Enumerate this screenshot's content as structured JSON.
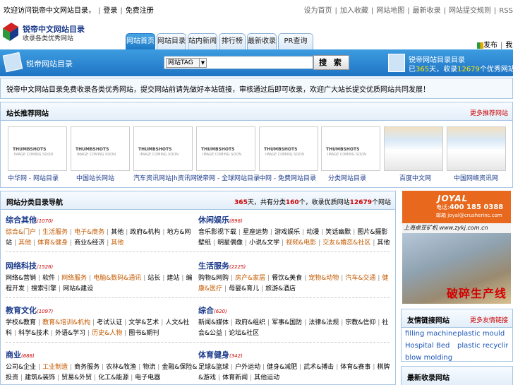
{
  "topbar": {
    "left_text": "欢迎访问锐帝中文网站目录，",
    "left_links": [
      "登录",
      "免费注册"
    ],
    "right_links": [
      "设为首页",
      "加入收藏",
      "网站地图",
      "最新收录",
      "网站提交规则",
      "RSS"
    ]
  },
  "logo": {
    "title": "锐帝中文网站目录",
    "subtitle": "收录各类优秀网站"
  },
  "tabs": [
    "网站首页",
    "网站目录",
    "站内新闻",
    "排行榜",
    "最新收录",
    "PR查询"
  ],
  "header_right": {
    "a": "发布",
    "b": "我的"
  },
  "bluebar": {
    "title": "锐帝网站目录",
    "search_select": "网站TAG",
    "search_button": "搜 索",
    "stats_title": "锐帝网站目录目录",
    "stats_prefix": "已",
    "stats_days": "365",
    "stats_mid": "天，收录",
    "stats_sites": "12679",
    "stats_suffix": "个优秀网站"
  },
  "notice": "锐帝中文网站目录免费收录各类优秀网站，提交网站前请先做好本站链接，审核通过后即可收录，欢迎广大站长提交优质网站共同发展！",
  "recommend": {
    "title": "站长推荐网站",
    "more": "更多推荐网站",
    "items": [
      {
        "caption": "中华网 - 网站目录",
        "img": "THUMBSHOTS",
        "img_sub": "IMAGE COMING SOON"
      },
      {
        "caption": "中国站长网站",
        "img": "THUMBSHOTS",
        "img_sub": "IMAGE COMING SOON"
      },
      {
        "caption": "汽车资讯网站|h资讯网",
        "img": "THUMBSHOTS",
        "img_sub": "IMAGE COMING SOON"
      },
      {
        "caption": "锐帝网 - 全球网站目录",
        "img": "THUMBSHOTS",
        "img_sub": "IMAGE COMING SOON"
      },
      {
        "caption": "中网 - 免费网站目录",
        "img": "THUMBSHOTS",
        "img_sub": "IMAGE COMING SOON"
      },
      {
        "caption": "分类网站目录",
        "img": "THUMBSHOTS",
        "img_sub": "IMAGE COMING SOON"
      },
      {
        "caption": "百度中文网",
        "img": "",
        "img_sub": ""
      },
      {
        "caption": "中国网络资讯网",
        "img": "",
        "img_sub": ""
      }
    ]
  },
  "categories": {
    "title": "网站分类目录导航",
    "stats_days": "365",
    "stats_t1": "天，共有分类",
    "stats_cats": "160",
    "stats_t2": "个，收录优质网站",
    "stats_sites": "12679",
    "stats_t3": "个网站",
    "blocks": [
      {
        "name": "综合其他",
        "count": "(1070)",
        "links": [
          {
            "t": "综合&门户",
            "o": true
          },
          {
            "t": "生活服务",
            "o": true
          },
          {
            "t": "电子&商务",
            "o": true
          },
          {
            "t": "其他",
            "o": false
          },
          {
            "t": "政府&机构",
            "o": false
          },
          {
            "t": "地方&网站",
            "o": false
          },
          {
            "t": "其他",
            "o": true
          },
          {
            "t": "体育&健身",
            "o": true
          },
          {
            "t": "商业&经济",
            "o": false
          },
          {
            "t": "其他",
            "o": true
          }
        ]
      },
      {
        "name": "休闲娱乐",
        "count": "(898)",
        "links": [
          {
            "t": "音乐影视下载",
            "o": false
          },
          {
            "t": "星座运势",
            "o": false
          },
          {
            "t": "游戏娱乐",
            "o": false
          },
          {
            "t": "动漫",
            "o": false
          },
          {
            "t": "笑话幽默",
            "o": false
          },
          {
            "t": "图片&摄影壁纸",
            "o": false
          },
          {
            "t": "明星偶像",
            "o": false
          },
          {
            "t": "小说&文学",
            "o": false
          },
          {
            "t": "视频&电影",
            "o": true
          },
          {
            "t": "交友&婚恋&社区",
            "o": true
          },
          {
            "t": "其他",
            "o": false
          }
        ]
      },
      {
        "name": "网络科技",
        "count": "(1526)",
        "links": [
          {
            "t": "网络&营销",
            "o": false
          },
          {
            "t": "软件",
            "o": false
          },
          {
            "t": "网络服务",
            "o": true
          },
          {
            "t": "电脑&数码&通讯",
            "o": true
          },
          {
            "t": "站长",
            "o": false
          },
          {
            "t": "建站",
            "o": false
          },
          {
            "t": "编程开发",
            "o": false
          },
          {
            "t": "搜索引擎",
            "o": false
          },
          {
            "t": "网站&建设",
            "o": false
          }
        ]
      },
      {
        "name": "生活服务",
        "count": "(2225)",
        "links": [
          {
            "t": "购物&网购",
            "o": false
          },
          {
            "t": "房产&家居",
            "o": true
          },
          {
            "t": "餐饮&美食",
            "o": false
          },
          {
            "t": "宠物&动物",
            "o": true
          },
          {
            "t": "汽车&交通",
            "o": true
          },
          {
            "t": "健康&医疗",
            "o": true
          },
          {
            "t": "母婴&育儿",
            "o": false
          },
          {
            "t": "旅游&酒店",
            "o": false
          }
        ]
      },
      {
        "name": "教育文化",
        "count": "(1097)",
        "links": [
          {
            "t": "学校&教育",
            "o": false
          },
          {
            "t": "教育&培训&机构",
            "o": true
          },
          {
            "t": "考试认证",
            "o": false
          },
          {
            "t": "文学&艺术",
            "o": false
          },
          {
            "t": "人文&社科",
            "o": false
          },
          {
            "t": "科学&技术",
            "o": false
          },
          {
            "t": "外语&学习",
            "o": false
          },
          {
            "t": "历史&人物",
            "o": true
          },
          {
            "t": "图书&期刊",
            "o": false
          }
        ]
      },
      {
        "name": "综合",
        "count": "(620)",
        "links": [
          {
            "t": "新闻&媒体",
            "o": false
          },
          {
            "t": "政府&组织",
            "o": false
          },
          {
            "t": "军事&国防",
            "o": false
          },
          {
            "t": "法律&法规",
            "o": false
          },
          {
            "t": "宗教&信仰",
            "o": false
          },
          {
            "t": "社会&公益",
            "o": false
          },
          {
            "t": "论坛&社区",
            "o": false
          }
        ]
      },
      {
        "name": "商业",
        "count": "(688)",
        "links": [
          {
            "t": "公司&企业",
            "o": false
          },
          {
            "t": "工业制造",
            "o": true
          },
          {
            "t": "商务服务",
            "o": false
          },
          {
            "t": "农林&牧渔",
            "o": false
          },
          {
            "t": "物流",
            "o": false
          },
          {
            "t": "金融&保险&投资",
            "o": false
          },
          {
            "t": "建筑&装饰",
            "o": false
          },
          {
            "t": "贸易&外贸",
            "o": false
          },
          {
            "t": "化工&能源",
            "o": false
          },
          {
            "t": "电子电器",
            "o": false
          }
        ]
      },
      {
        "name": "体育健身",
        "count": "(342)",
        "links": [
          {
            "t": "足球&篮球",
            "o": false
          },
          {
            "t": "户外运动",
            "o": false
          },
          {
            "t": "健身&减肥",
            "o": false
          },
          {
            "t": "武术&搏击",
            "o": false
          },
          {
            "t": "体育&赛事",
            "o": false
          },
          {
            "t": "棋牌&游戏",
            "o": false
          },
          {
            "t": "体育新闻",
            "o": false
          },
          {
            "t": "其他运动",
            "o": false
          }
        ]
      }
    ]
  },
  "ad": {
    "brand": "JOYAL",
    "tel_label": "电话:",
    "tel": "400 185 0388",
    "mail": "邮箱 joyal@crusherinc.com",
    "mid": "上海卓亚矿机 www.zykj.com.cn",
    "slogan": "破碎生产线"
  },
  "links_box": {
    "title": "友情链接网站",
    "more": "更多友情链接",
    "items": [
      "filling machine",
      "plastic mould",
      "Hospital Bed",
      "plastic recycling",
      "blow molding"
    ]
  },
  "latest_box": {
    "title": "最新收录网站"
  }
}
